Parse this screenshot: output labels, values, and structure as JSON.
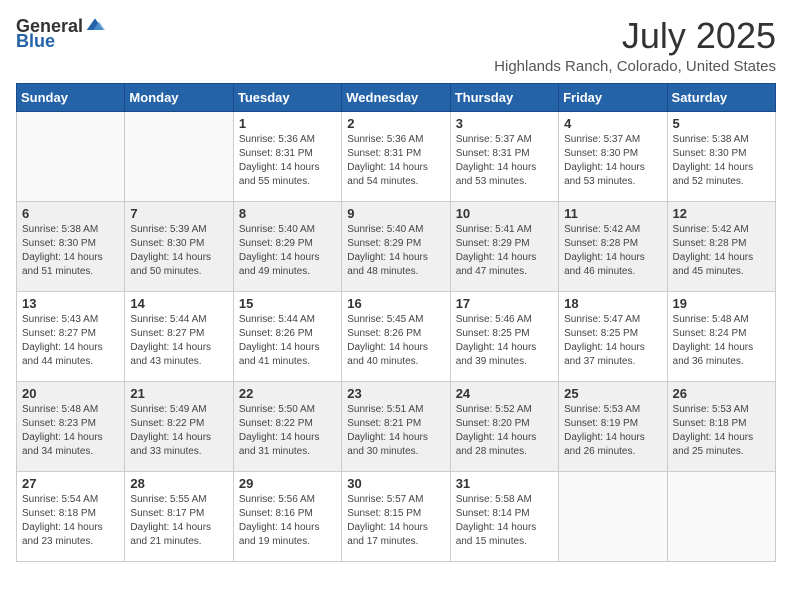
{
  "header": {
    "logo_general": "General",
    "logo_blue": "Blue",
    "month": "July 2025",
    "location": "Highlands Ranch, Colorado, United States"
  },
  "weekdays": [
    "Sunday",
    "Monday",
    "Tuesday",
    "Wednesday",
    "Thursday",
    "Friday",
    "Saturday"
  ],
  "weeks": [
    [
      {
        "day": "",
        "sunrise": "",
        "sunset": "",
        "daylight": ""
      },
      {
        "day": "",
        "sunrise": "",
        "sunset": "",
        "daylight": ""
      },
      {
        "day": "1",
        "sunrise": "Sunrise: 5:36 AM",
        "sunset": "Sunset: 8:31 PM",
        "daylight": "Daylight: 14 hours and 55 minutes."
      },
      {
        "day": "2",
        "sunrise": "Sunrise: 5:36 AM",
        "sunset": "Sunset: 8:31 PM",
        "daylight": "Daylight: 14 hours and 54 minutes."
      },
      {
        "day": "3",
        "sunrise": "Sunrise: 5:37 AM",
        "sunset": "Sunset: 8:31 PM",
        "daylight": "Daylight: 14 hours and 53 minutes."
      },
      {
        "day": "4",
        "sunrise": "Sunrise: 5:37 AM",
        "sunset": "Sunset: 8:30 PM",
        "daylight": "Daylight: 14 hours and 53 minutes."
      },
      {
        "day": "5",
        "sunrise": "Sunrise: 5:38 AM",
        "sunset": "Sunset: 8:30 PM",
        "daylight": "Daylight: 14 hours and 52 minutes."
      }
    ],
    [
      {
        "day": "6",
        "sunrise": "Sunrise: 5:38 AM",
        "sunset": "Sunset: 8:30 PM",
        "daylight": "Daylight: 14 hours and 51 minutes."
      },
      {
        "day": "7",
        "sunrise": "Sunrise: 5:39 AM",
        "sunset": "Sunset: 8:30 PM",
        "daylight": "Daylight: 14 hours and 50 minutes."
      },
      {
        "day": "8",
        "sunrise": "Sunrise: 5:40 AM",
        "sunset": "Sunset: 8:29 PM",
        "daylight": "Daylight: 14 hours and 49 minutes."
      },
      {
        "day": "9",
        "sunrise": "Sunrise: 5:40 AM",
        "sunset": "Sunset: 8:29 PM",
        "daylight": "Daylight: 14 hours and 48 minutes."
      },
      {
        "day": "10",
        "sunrise": "Sunrise: 5:41 AM",
        "sunset": "Sunset: 8:29 PM",
        "daylight": "Daylight: 14 hours and 47 minutes."
      },
      {
        "day": "11",
        "sunrise": "Sunrise: 5:42 AM",
        "sunset": "Sunset: 8:28 PM",
        "daylight": "Daylight: 14 hours and 46 minutes."
      },
      {
        "day": "12",
        "sunrise": "Sunrise: 5:42 AM",
        "sunset": "Sunset: 8:28 PM",
        "daylight": "Daylight: 14 hours and 45 minutes."
      }
    ],
    [
      {
        "day": "13",
        "sunrise": "Sunrise: 5:43 AM",
        "sunset": "Sunset: 8:27 PM",
        "daylight": "Daylight: 14 hours and 44 minutes."
      },
      {
        "day": "14",
        "sunrise": "Sunrise: 5:44 AM",
        "sunset": "Sunset: 8:27 PM",
        "daylight": "Daylight: 14 hours and 43 minutes."
      },
      {
        "day": "15",
        "sunrise": "Sunrise: 5:44 AM",
        "sunset": "Sunset: 8:26 PM",
        "daylight": "Daylight: 14 hours and 41 minutes."
      },
      {
        "day": "16",
        "sunrise": "Sunrise: 5:45 AM",
        "sunset": "Sunset: 8:26 PM",
        "daylight": "Daylight: 14 hours and 40 minutes."
      },
      {
        "day": "17",
        "sunrise": "Sunrise: 5:46 AM",
        "sunset": "Sunset: 8:25 PM",
        "daylight": "Daylight: 14 hours and 39 minutes."
      },
      {
        "day": "18",
        "sunrise": "Sunrise: 5:47 AM",
        "sunset": "Sunset: 8:25 PM",
        "daylight": "Daylight: 14 hours and 37 minutes."
      },
      {
        "day": "19",
        "sunrise": "Sunrise: 5:48 AM",
        "sunset": "Sunset: 8:24 PM",
        "daylight": "Daylight: 14 hours and 36 minutes."
      }
    ],
    [
      {
        "day": "20",
        "sunrise": "Sunrise: 5:48 AM",
        "sunset": "Sunset: 8:23 PM",
        "daylight": "Daylight: 14 hours and 34 minutes."
      },
      {
        "day": "21",
        "sunrise": "Sunrise: 5:49 AM",
        "sunset": "Sunset: 8:22 PM",
        "daylight": "Daylight: 14 hours and 33 minutes."
      },
      {
        "day": "22",
        "sunrise": "Sunrise: 5:50 AM",
        "sunset": "Sunset: 8:22 PM",
        "daylight": "Daylight: 14 hours and 31 minutes."
      },
      {
        "day": "23",
        "sunrise": "Sunrise: 5:51 AM",
        "sunset": "Sunset: 8:21 PM",
        "daylight": "Daylight: 14 hours and 30 minutes."
      },
      {
        "day": "24",
        "sunrise": "Sunrise: 5:52 AM",
        "sunset": "Sunset: 8:20 PM",
        "daylight": "Daylight: 14 hours and 28 minutes."
      },
      {
        "day": "25",
        "sunrise": "Sunrise: 5:53 AM",
        "sunset": "Sunset: 8:19 PM",
        "daylight": "Daylight: 14 hours and 26 minutes."
      },
      {
        "day": "26",
        "sunrise": "Sunrise: 5:53 AM",
        "sunset": "Sunset: 8:18 PM",
        "daylight": "Daylight: 14 hours and 25 minutes."
      }
    ],
    [
      {
        "day": "27",
        "sunrise": "Sunrise: 5:54 AM",
        "sunset": "Sunset: 8:18 PM",
        "daylight": "Daylight: 14 hours and 23 minutes."
      },
      {
        "day": "28",
        "sunrise": "Sunrise: 5:55 AM",
        "sunset": "Sunset: 8:17 PM",
        "daylight": "Daylight: 14 hours and 21 minutes."
      },
      {
        "day": "29",
        "sunrise": "Sunrise: 5:56 AM",
        "sunset": "Sunset: 8:16 PM",
        "daylight": "Daylight: 14 hours and 19 minutes."
      },
      {
        "day": "30",
        "sunrise": "Sunrise: 5:57 AM",
        "sunset": "Sunset: 8:15 PM",
        "daylight": "Daylight: 14 hours and 17 minutes."
      },
      {
        "day": "31",
        "sunrise": "Sunrise: 5:58 AM",
        "sunset": "Sunset: 8:14 PM",
        "daylight": "Daylight: 14 hours and 15 minutes."
      },
      {
        "day": "",
        "sunrise": "",
        "sunset": "",
        "daylight": ""
      },
      {
        "day": "",
        "sunrise": "",
        "sunset": "",
        "daylight": ""
      }
    ]
  ]
}
